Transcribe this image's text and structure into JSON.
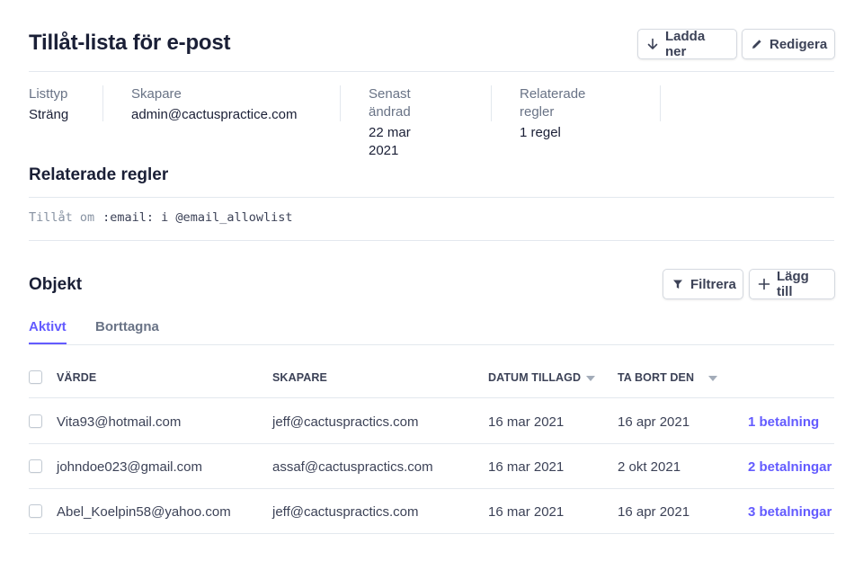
{
  "header": {
    "title": "Tillåt-lista för e-post",
    "download_label": "Ladda ner",
    "edit_label": "Redigera"
  },
  "meta": [
    {
      "label": "Listtyp",
      "value": "Sträng"
    },
    {
      "label": "Skapare",
      "value": "admin@cactuspractice.com"
    },
    {
      "label": "Senast ändrad",
      "value": "22 mar 2021"
    },
    {
      "label": "Relaterade regler",
      "value": "1 regel"
    }
  ],
  "rules": {
    "title": "Relaterade regler",
    "keyword": "Tillåt om",
    "expression": ":email: i @email_allowlist"
  },
  "objects": {
    "title": "Objekt",
    "filter_label": "Filtrera",
    "add_label": "Lägg till",
    "tabs": [
      {
        "label": "Aktivt",
        "active": true
      },
      {
        "label": "Borttagna",
        "active": false
      }
    ],
    "columns": [
      "VÄRDE",
      "SKAPARE",
      "DATUM TILLAGD",
      "TA BORT DEN"
    ],
    "rows": [
      {
        "value": "Vita93@hotmail.com",
        "creator": "jeff@cactuspractics.com",
        "added": "16 mar 2021",
        "remove": "16 apr 2021",
        "payments": "1 betalning"
      },
      {
        "value": "johndoe023@gmail.com",
        "creator": "assaf@cactuspractics.com",
        "added": "16 mar 2021",
        "remove": "2 okt 2021",
        "payments": "2 betalningar"
      },
      {
        "value": "Abel_Koelpin58@yahoo.com",
        "creator": "jeff@cactuspractics.com",
        "added": "16 mar 2021",
        "remove": "16 apr 2021",
        "payments": "3 betalningar"
      }
    ]
  },
  "colors": {
    "accent": "#635bff",
    "text": "#1a1f36",
    "muted": "#697386",
    "border": "#e3e8ee"
  },
  "icons": {
    "download": "arrow-down-icon",
    "edit": "pencil-icon",
    "filter": "funnel-icon",
    "add": "plus-icon"
  }
}
